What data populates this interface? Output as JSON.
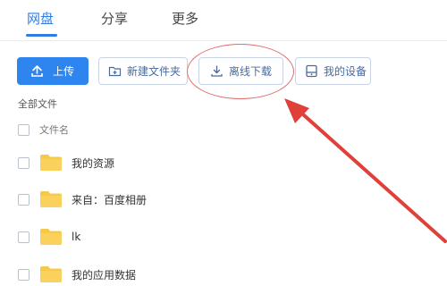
{
  "tabs": [
    {
      "label": "网盘",
      "active": true
    },
    {
      "label": "分享",
      "active": false
    },
    {
      "label": "更多",
      "active": false
    }
  ],
  "toolbar": {
    "upload_label": "上传",
    "new_folder_label": "新建文件夹",
    "offline_download_label": "离线下载",
    "my_devices_label": "我的设备"
  },
  "section": {
    "label": "全部文件"
  },
  "list": {
    "header": "文件名",
    "items": [
      {
        "name": "我的资源",
        "icon": "folder-icon"
      },
      {
        "name": "来自：百度相册",
        "icon": "folder-icon"
      },
      {
        "name": "lk",
        "icon": "folder-icon"
      },
      {
        "name": "我的应用数据",
        "icon": "folder-icon"
      }
    ]
  },
  "colors": {
    "accent": "#2f7de1",
    "primary_button": "#2f85f0",
    "annotation": "#e0403a",
    "folder": "#f7c948"
  }
}
